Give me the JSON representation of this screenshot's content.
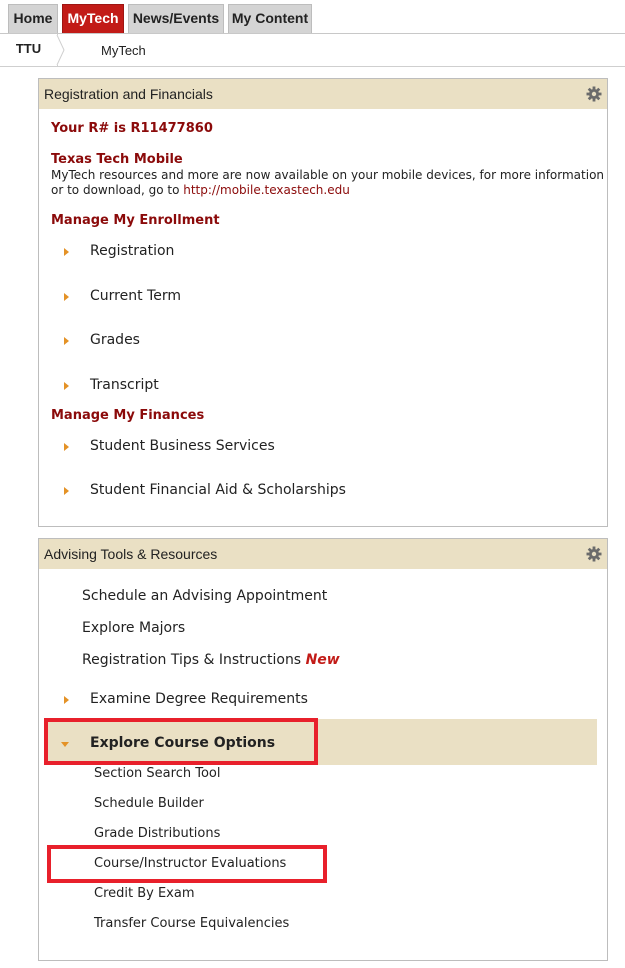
{
  "tabs": [
    "Home",
    "MyTech",
    "News/Events",
    "My Content"
  ],
  "breadcrumb": {
    "root": "TTU",
    "current": "MyTech"
  },
  "registration": {
    "title": "Registration and Financials",
    "rnumber": "Your R# is R11477860",
    "mobile_title": "Texas Tech Mobile",
    "mobile_line1": "MyTech resources and more are now available on your mobile devices, for more information",
    "mobile_line2_prefix": "or to download, go to ",
    "mobile_link": "http://mobile.texastech.edu",
    "enrollment_heading": "Manage My Enrollment",
    "enrollment_items": [
      "Registration",
      "Current Term",
      "Grades",
      "Transcript"
    ],
    "finances_heading": "Manage My Finances",
    "finances_items": [
      "Student Business Services",
      "Student Financial Aid & Scholarships"
    ]
  },
  "advising": {
    "title": "Advising Tools & Resources",
    "links": [
      "Schedule an Advising Appointment",
      "Explore Majors",
      "Registration Tips & Instructions"
    ],
    "new_label": "New",
    "degree_item": "Examine Degree Requirements",
    "course_options": "Explore Course Options",
    "course_sub": [
      "Section Search Tool",
      "Schedule Builder",
      "Grade Distributions",
      "Course/Instructor Evaluations",
      "Credit By Exam",
      "Transfer Course Equivalencies"
    ]
  },
  "colors": {
    "accent_red": "#c21b17",
    "heading_red": "#8b0a0a",
    "portlet_header": "#eae0c4",
    "bullet_orange": "#e49226",
    "highlight_box": "#e8202b"
  },
  "icons": {
    "portlet_settings": "gear-icon",
    "bullet": "triangle-right-icon",
    "expanded": "triangle-down-icon"
  }
}
